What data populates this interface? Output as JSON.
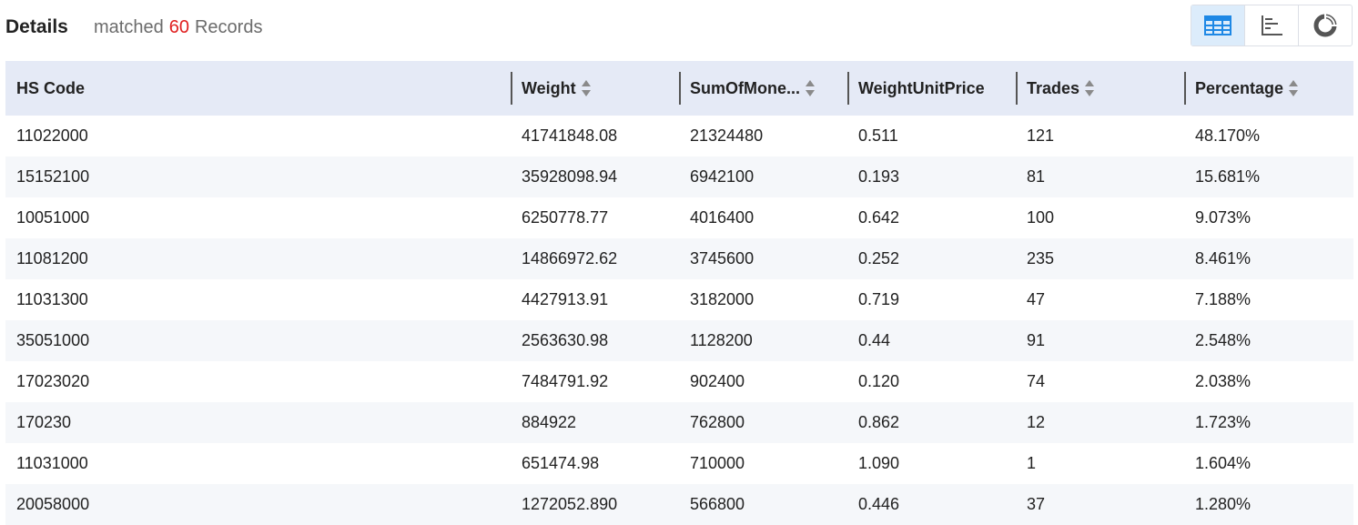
{
  "header": {
    "title": "Details",
    "matched_prefix": "matched",
    "matched_count": "60",
    "matched_suffix": "Records"
  },
  "view_switch": {
    "buttons": [
      {
        "icon": "table-view-icon",
        "active": true
      },
      {
        "icon": "bar-chart-view-icon",
        "active": false
      },
      {
        "icon": "donut-chart-view-icon",
        "active": false
      }
    ],
    "active_color": "#1e88e5"
  },
  "table": {
    "columns": [
      {
        "label": "HS Code",
        "sortable": false
      },
      {
        "label": "Weight",
        "sortable": true
      },
      {
        "label": "SumOfMone...",
        "sortable": true
      },
      {
        "label": "WeightUnitPrice",
        "sortable": false
      },
      {
        "label": "Trades",
        "sortable": true
      },
      {
        "label": "Percentage",
        "sortable": true
      }
    ],
    "rows": [
      [
        "11022000",
        "41741848.08",
        "21324480",
        "0.511",
        "121",
        "48.170%"
      ],
      [
        "15152100",
        "35928098.94",
        "6942100",
        "0.193",
        "81",
        "15.681%"
      ],
      [
        "10051000",
        "6250778.77",
        "4016400",
        "0.642",
        "100",
        "9.073%"
      ],
      [
        "11081200",
        "14866972.62",
        "3745600",
        "0.252",
        "235",
        "8.461%"
      ],
      [
        "11031300",
        "4427913.91",
        "3182000",
        "0.719",
        "47",
        "7.188%"
      ],
      [
        "35051000",
        "2563630.98",
        "1128200",
        "0.44",
        "91",
        "2.548%"
      ],
      [
        "17023020",
        "7484791.92",
        "902400",
        "0.120",
        "74",
        "2.038%"
      ],
      [
        "170230",
        "884922",
        "762800",
        "0.862",
        "12",
        "1.723%"
      ],
      [
        "11031000",
        "651474.98",
        "710000",
        "1.090",
        "1",
        "1.604%"
      ],
      [
        "20058000",
        "1272052.890",
        "566800",
        "0.446",
        "37",
        "1.280%"
      ]
    ]
  }
}
